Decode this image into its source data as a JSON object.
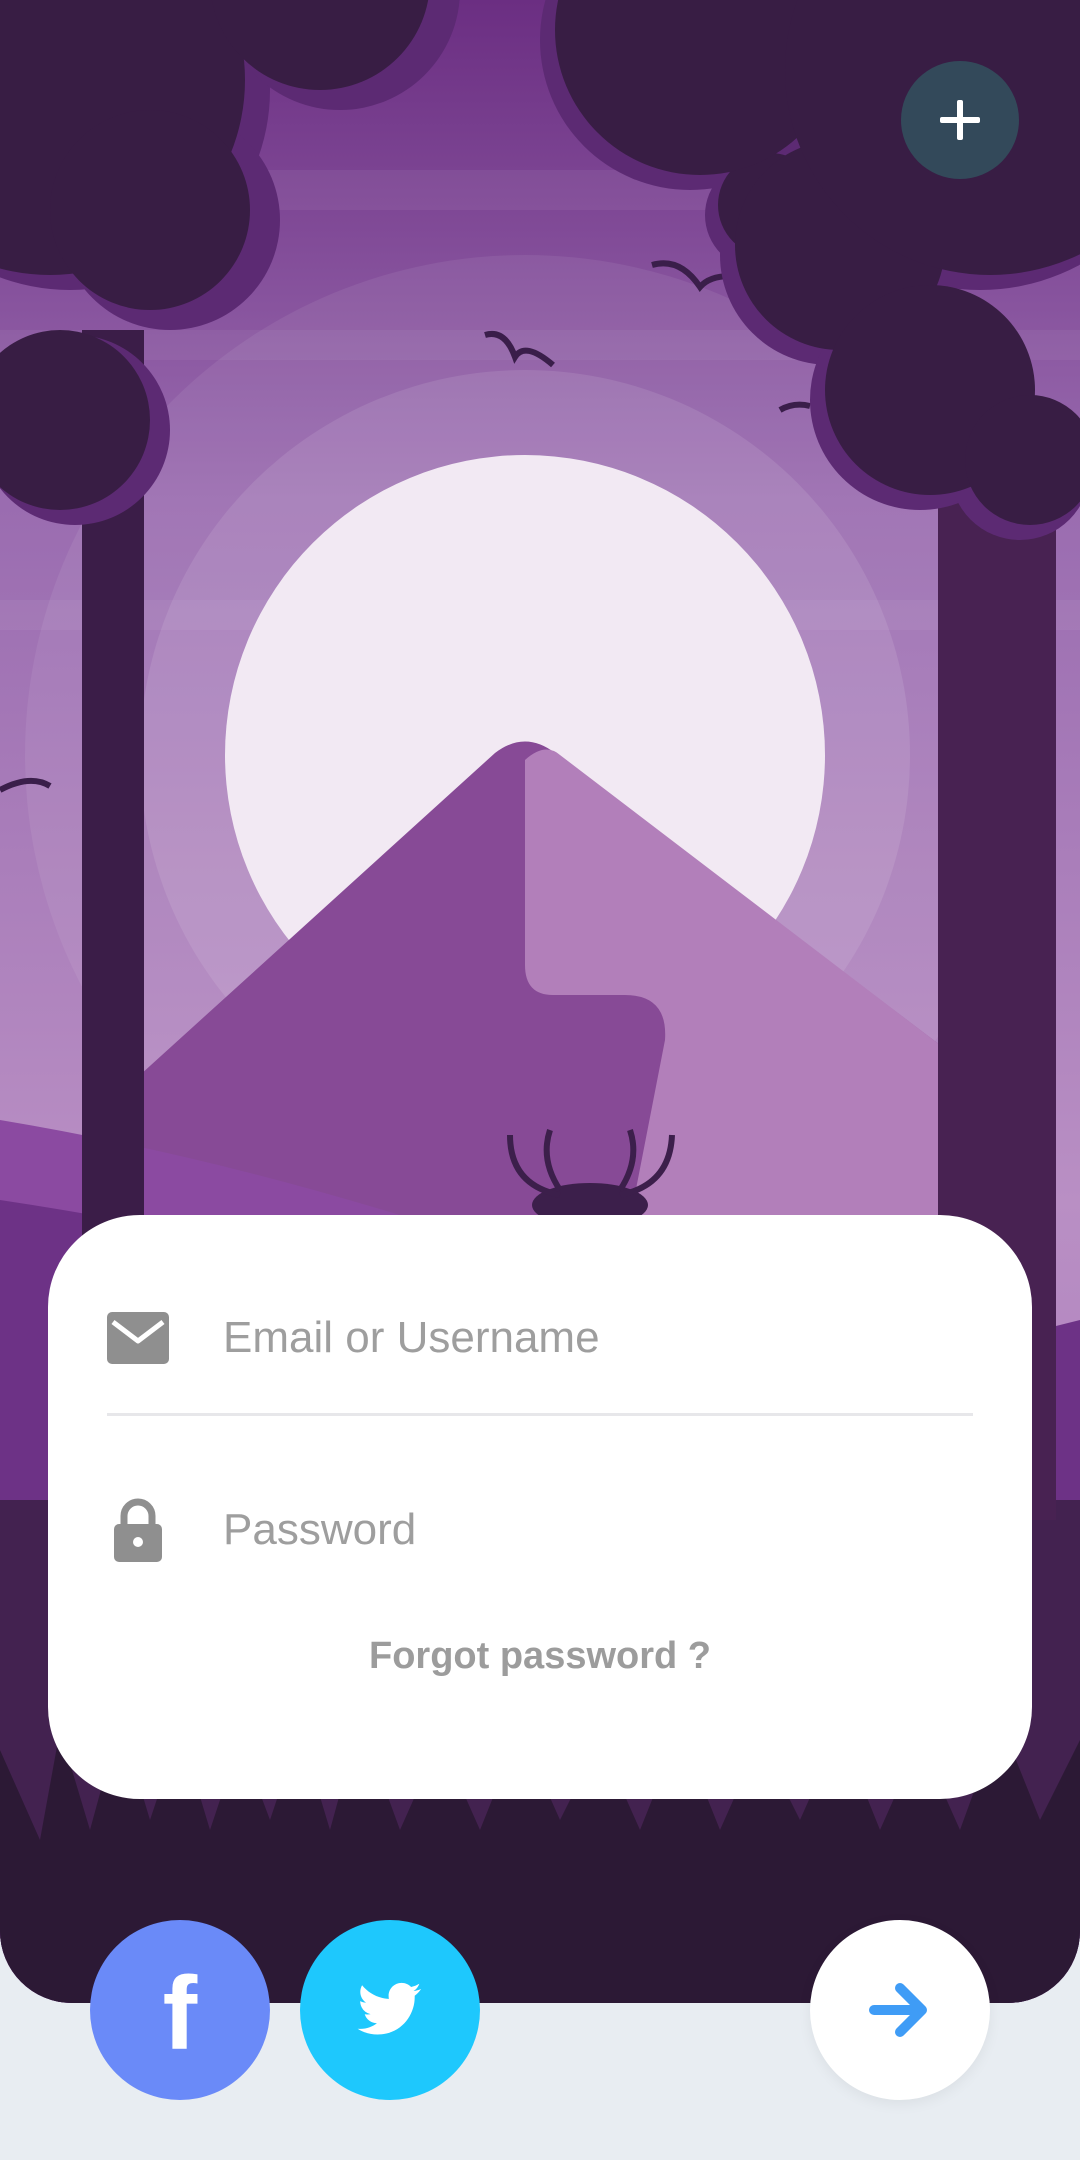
{
  "header": {
    "add_icon": "plus-icon"
  },
  "login_form": {
    "email_placeholder": "Email or Username",
    "email_icon": "envelope-icon",
    "password_placeholder": "Password",
    "password_icon": "lock-icon",
    "forgot_label": "Forgot password ?"
  },
  "actions": {
    "facebook_icon": "facebook-icon",
    "twitter_icon": "twitter-icon",
    "next_icon": "arrow-right-icon"
  },
  "colors": {
    "sky": "#8a5ea8",
    "dark_purple": "#371d42",
    "facebook": "#6a8af8",
    "twitter": "#1ec8fd",
    "arrow": "#3f9cf6",
    "fab": "#33495a"
  }
}
